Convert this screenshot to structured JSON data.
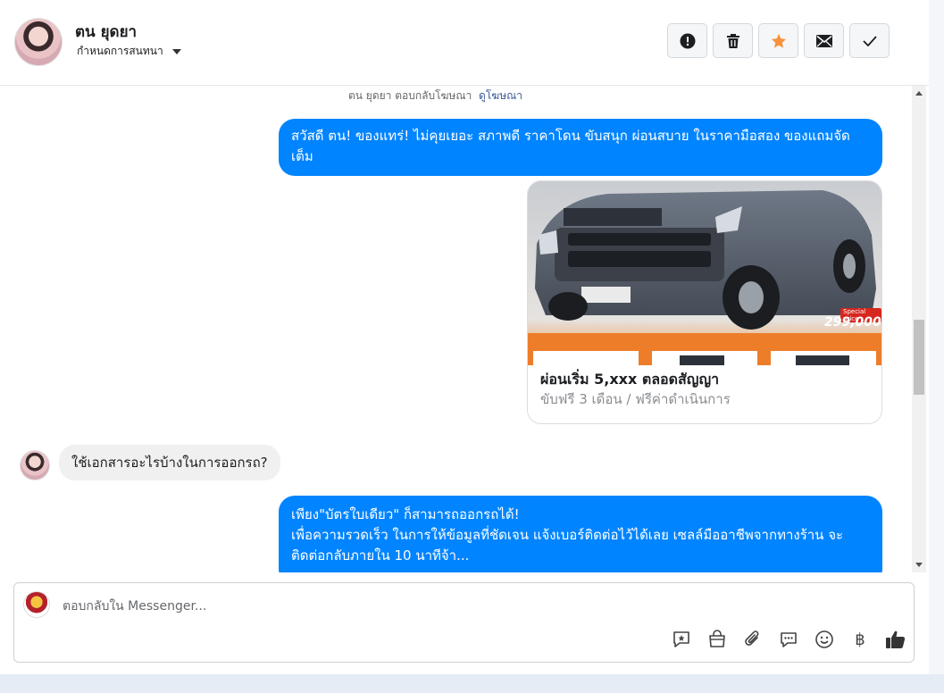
{
  "contact": {
    "name": "ตน ยุดยา",
    "assign_label": "กำหนดการสนทนา"
  },
  "header_actions": [
    {
      "icon": "alert-icon",
      "color": "#1c1e21"
    },
    {
      "icon": "trash-icon",
      "color": "#1c1e21"
    },
    {
      "icon": "star-icon",
      "color": "#f7923b"
    },
    {
      "icon": "mail-icon",
      "color": "#1c1e21"
    },
    {
      "icon": "check-icon",
      "color": "#1c1e21"
    }
  ],
  "conversation": {
    "ad_reply_text": "ตน ยุดยา ตอบกลับโฆษณา",
    "ad_link": "ดูโฆษณา",
    "msg1": "สวัสดี ตน! ของแทร่! ไม่คุยเยอะ สภาพดี ราคาโดน ขับสนุก ผ่อนสบาย ในราคามือสอง ของแถมจัดเต็ม",
    "card": {
      "price": "299,000.-",
      "badge": "Special price",
      "title": "ผ่อนเริ่ม 5,xxx ตลอดสัญญา",
      "subtitle": "ขับฟรี 3 เดือน / ฟรีค่าดำเนินการ"
    },
    "msg2": "ใช้เอกสารอะไรบ้างในการออกรถ?",
    "msg3_line1": "เพียง\"บัตรใบเดียว\" ก็สามารถออกรถได้!",
    "msg3_line2": "เพื่อความรวดเร็ว ในการให้ข้อมูลที่ชัดเจน แจ้งเบอร์ติดต่อไว้ได้เลย เซลล์มืออาชีพจากทางร้าน จะติดต่อกลับภายใน 10 นาทีจ้า..."
  },
  "composer": {
    "placeholder": "ตอบกลับใน Messenger...",
    "tools": [
      "quick-reply-icon",
      "shop-bag-icon",
      "attachment-icon",
      "saved-reply-icon",
      "emoji-icon",
      "baht-icon",
      "thumbs-up-icon"
    ],
    "baht_symbol": "฿"
  },
  "colors": {
    "outgoing_bubble": "#0084ff",
    "incoming_bubble": "#f0f0f0",
    "accent_star": "#f7923b"
  }
}
